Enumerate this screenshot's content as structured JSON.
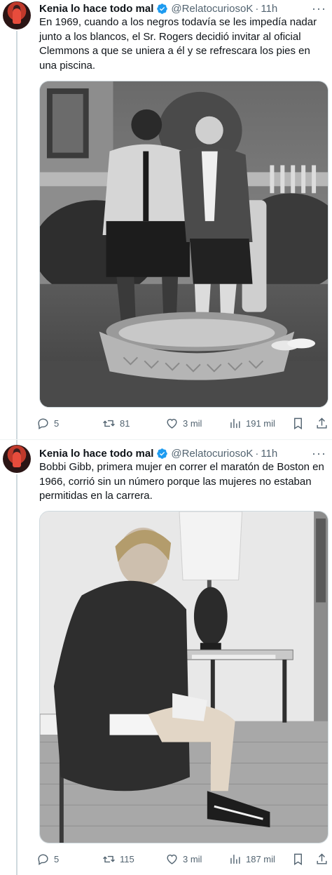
{
  "tweets": [
    {
      "author": {
        "name": "Kenia lo hace todo mal",
        "handle": "@RelatocuriosoK",
        "verified": true
      },
      "separator": "·",
      "time": "11h",
      "text": "En 1969, cuando a los negros todavía se les impedía nadar junto a los blancos, el Sr. Rogers decidió invitar al oficial Clemmons a que se uniera a él y se refrescara los pies en una piscina.",
      "stats": {
        "replies": "5",
        "retweets": "81",
        "likes": "3 mil",
        "views": "191 mil"
      }
    },
    {
      "author": {
        "name": "Kenia lo hace todo mal",
        "handle": "@RelatocuriosoK",
        "verified": true
      },
      "separator": "·",
      "time": "11h",
      "text": "Bobbi Gibb, primera mujer en correr el maratón de Boston en 1966, corrió sin un número porque las mujeres no estaban permitidas en la carrera.",
      "stats": {
        "replies": "5",
        "retweets": "115",
        "likes": "3 mil",
        "views": "187 mil"
      }
    }
  ],
  "colors": {
    "verified": "#1d9bf0",
    "secondary_text": "#536471",
    "divider": "#eff3f4"
  },
  "icons": [
    "more-icon",
    "verified-badge-icon",
    "reply-icon",
    "retweet-icon",
    "like-icon",
    "views-icon",
    "bookmark-icon",
    "share-icon"
  ]
}
